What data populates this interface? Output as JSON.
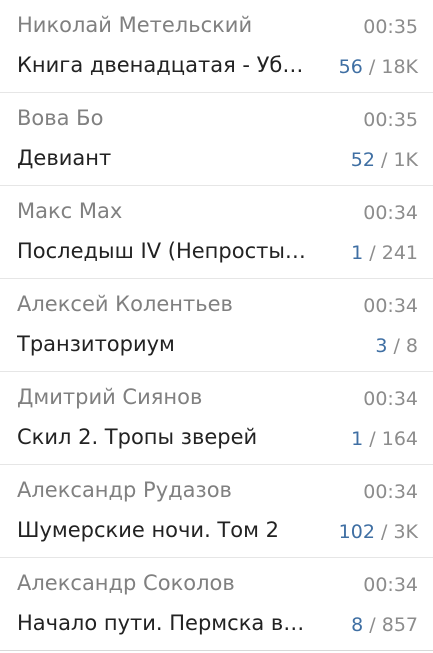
{
  "items": [
    {
      "author": "Николай Метельский",
      "time": "00:35",
      "title": "Книга двенадцатая - Уб…",
      "new_count": "56",
      "separator": "/",
      "total_count": "18K"
    },
    {
      "author": "Вова Бо",
      "time": "00:35",
      "title": "Девиант",
      "new_count": "52",
      "separator": "/",
      "total_count": "1K"
    },
    {
      "author": "Макс Мах",
      "time": "00:34",
      "title": "Последыш IV (Непросты…",
      "new_count": "1",
      "separator": "/",
      "total_count": "241"
    },
    {
      "author": "Алексей Колентьев",
      "time": "00:34",
      "title": "Транзиториум",
      "new_count": "3",
      "separator": "/",
      "total_count": "8"
    },
    {
      "author": "Дмитрий Сиянов",
      "time": "00:34",
      "title": "Скил 2. Тропы зверей",
      "new_count": "1",
      "separator": "/",
      "total_count": "164"
    },
    {
      "author": "Александр Рудазов",
      "time": "00:34",
      "title": "Шумерские ночи. Том 2",
      "new_count": "102",
      "separator": "/",
      "total_count": "3K"
    },
    {
      "author": "Александр Соколов",
      "time": "00:34",
      "title": "Начало пути. Пермска в…",
      "new_count": "8",
      "separator": "/",
      "total_count": "857"
    }
  ]
}
